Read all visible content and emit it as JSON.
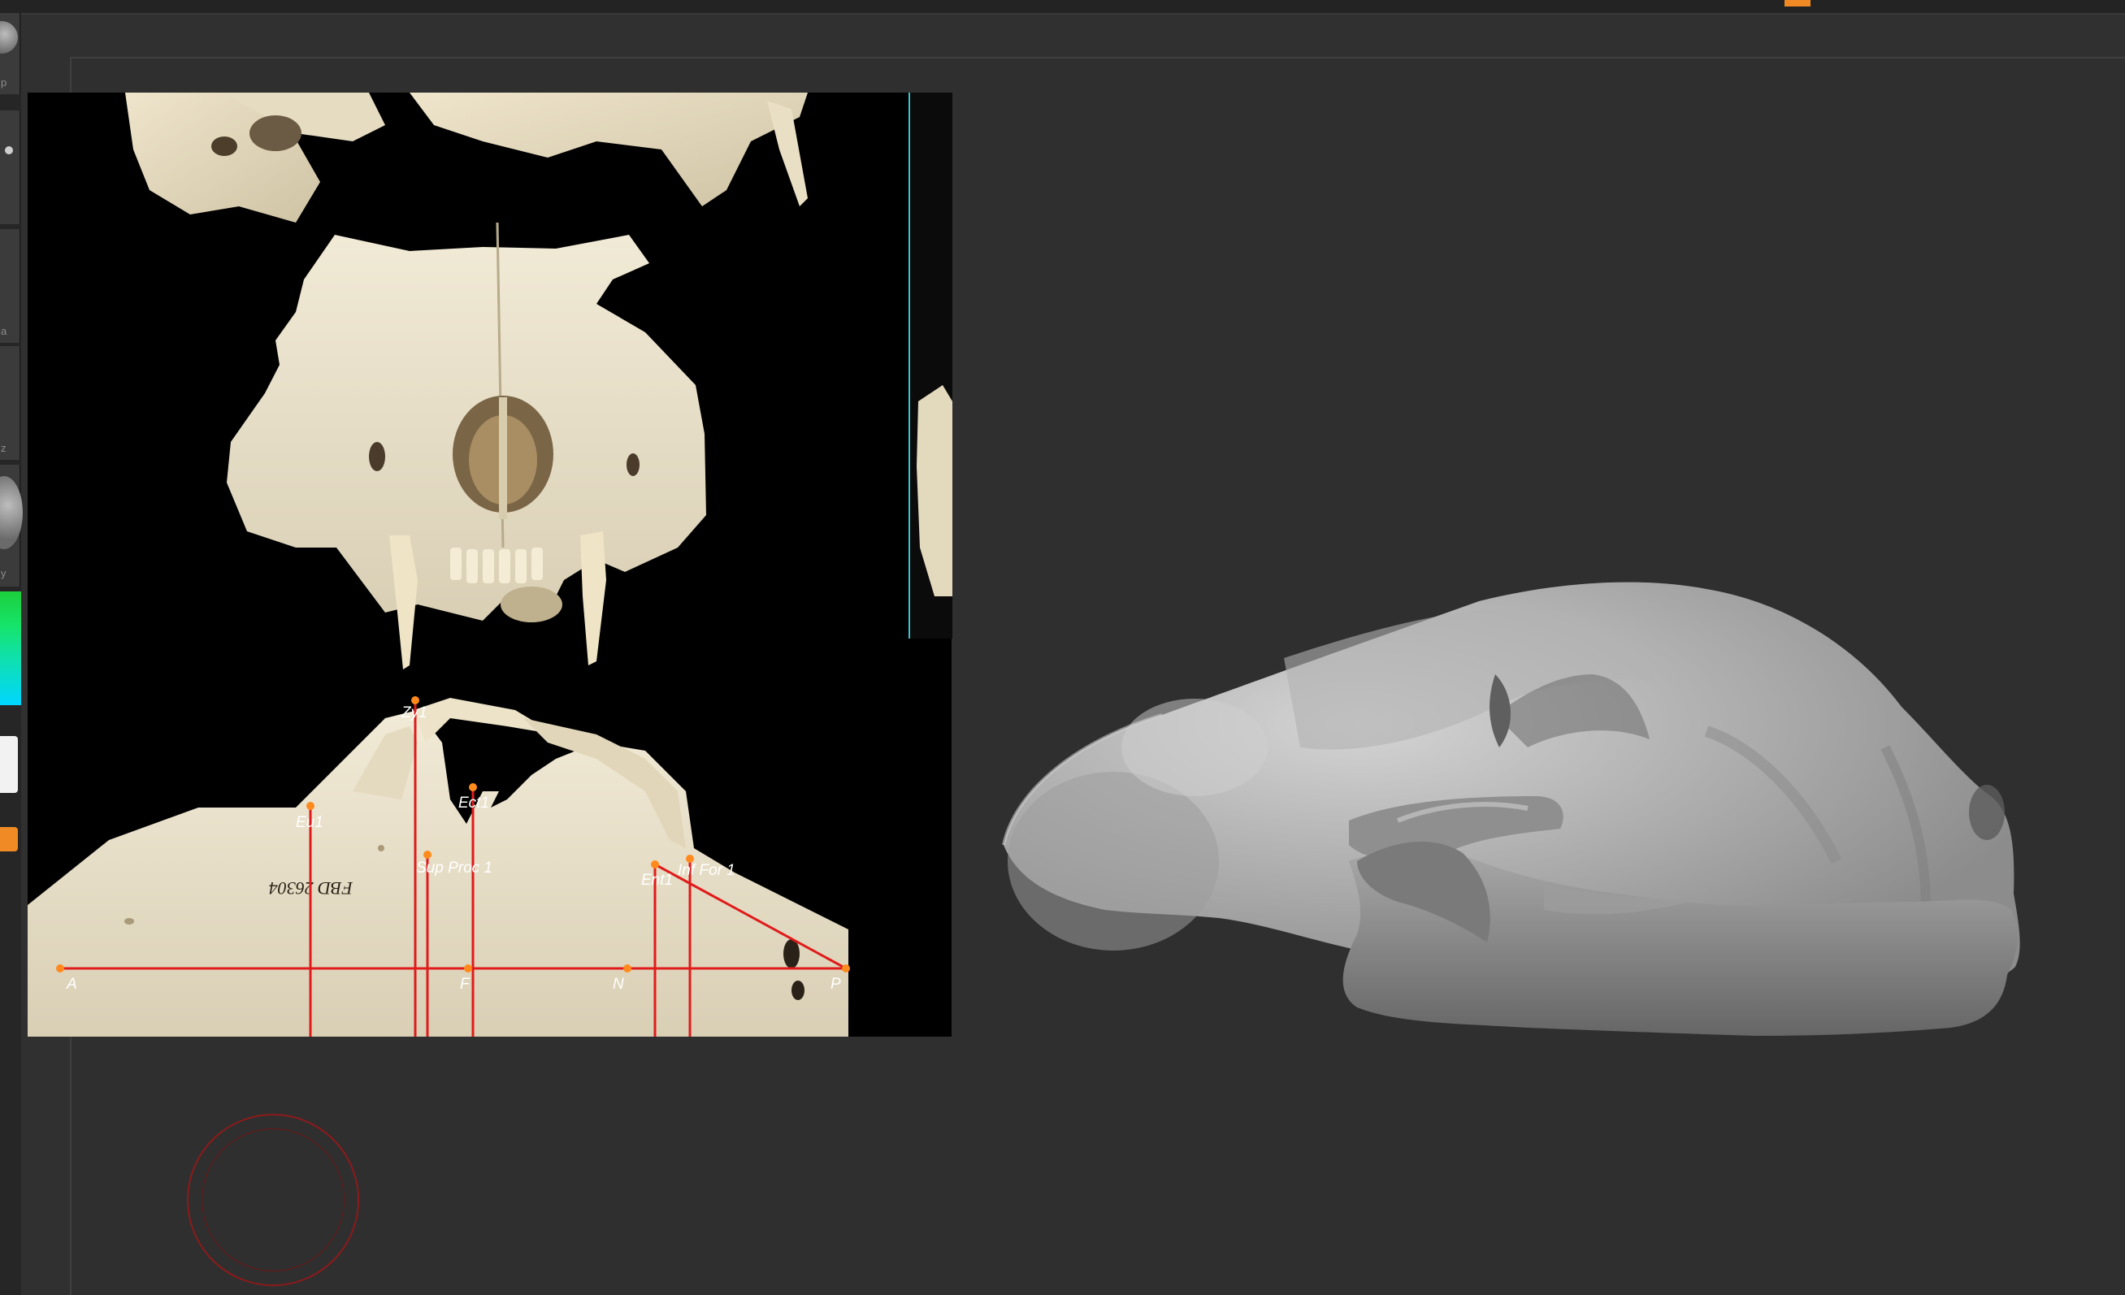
{
  "colors": {
    "background": "#303030",
    "accent": "#f08a24",
    "measurement_line": "#e01b1b",
    "landmark_point": "#ff8a1e",
    "cursor_ring": "#8d1a1a",
    "reference_border": "#3cc3cc"
  },
  "toolbar": {
    "captions": [
      "p",
      "a",
      "z",
      "y"
    ]
  },
  "reference": {
    "specimen_tag": "FBD 26304",
    "landmarks": [
      {
        "key": "zy1",
        "label": "Zy1"
      },
      {
        "key": "eu1",
        "label": "Eu1"
      },
      {
        "key": "ect1",
        "label": "Ect1"
      },
      {
        "key": "sup_proc_1",
        "label": "Sup Proc 1"
      },
      {
        "key": "ent1",
        "label": "Ent1"
      },
      {
        "key": "inf_for_1",
        "label": "Inf For 1"
      },
      {
        "key": "a",
        "label": "A"
      },
      {
        "key": "f",
        "label": "F"
      },
      {
        "key": "n",
        "label": "N"
      },
      {
        "key": "p",
        "label": "P"
      }
    ]
  },
  "viewport": {
    "model": "sculpted-skull-mesh",
    "cursor": "brush-cursor"
  }
}
